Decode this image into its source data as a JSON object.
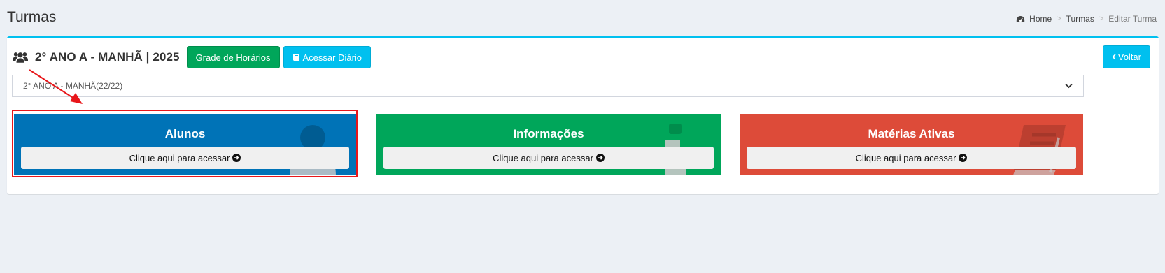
{
  "header": {
    "title": "Turmas",
    "breadcrumb": [
      "Home",
      "Turmas",
      "Editar Turma"
    ],
    "separator": ">"
  },
  "box": {
    "title": "2° ANO A - MANHÃ | 2025",
    "btn_grade": "Grade de Horários",
    "btn_diario": "Acessar Diário",
    "btn_voltar": "Voltar",
    "select_value": "2° ANO A - MANHÃ(22/22)"
  },
  "tiles": [
    {
      "title": "Alunos",
      "button": "Clique aqui para acessar",
      "color": "#0073b7",
      "icon": "user-icon"
    },
    {
      "title": "Informações",
      "button": "Clique aqui para acessar",
      "color": "#00a65a",
      "icon": "info-icon"
    },
    {
      "title": "Matérias Ativas",
      "button": "Clique aqui para acessar",
      "color": "#dd4b39",
      "icon": "book-icon"
    }
  ],
  "colors": {
    "accent_top": "#00c0ef",
    "highlight": "#e8161a",
    "background": "#ecf0f5"
  }
}
